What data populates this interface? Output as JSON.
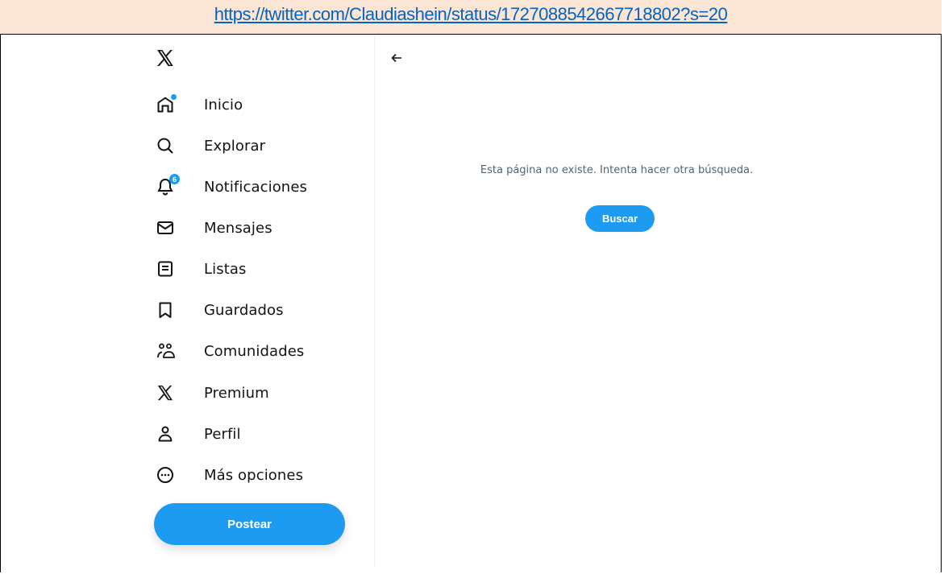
{
  "url_bar": {
    "url": "https://twitter.com/Claudiashein/status/1727088542667718802?s=20"
  },
  "sidebar": {
    "items": [
      {
        "label": "Inicio",
        "icon": "home-icon"
      },
      {
        "label": "Explorar",
        "icon": "search-icon"
      },
      {
        "label": "Notificaciones",
        "icon": "bell-icon",
        "badge": "6"
      },
      {
        "label": "Mensajes",
        "icon": "envelope-icon"
      },
      {
        "label": "Listas",
        "icon": "list-icon"
      },
      {
        "label": "Guardados",
        "icon": "bookmark-icon"
      },
      {
        "label": "Comunidades",
        "icon": "communities-icon"
      },
      {
        "label": "Premium",
        "icon": "x-logo-icon"
      },
      {
        "label": "Perfil",
        "icon": "profile-icon"
      },
      {
        "label": "Más opciones",
        "icon": "more-icon"
      }
    ],
    "post_label": "Postear"
  },
  "main": {
    "error_message": "Esta página no existe. Intenta hacer otra búsqueda.",
    "search_label": "Buscar"
  },
  "colors": {
    "accent": "#1d9bf0",
    "url_bar_bg": "#fbe5d5",
    "link": "#0563c1"
  }
}
